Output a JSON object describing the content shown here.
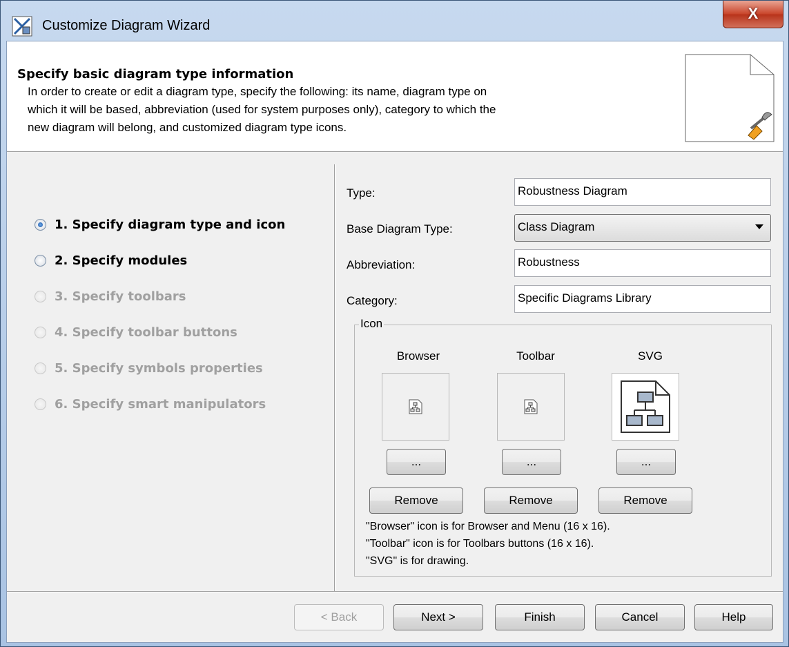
{
  "window": {
    "title": "Customize Diagram Wizard",
    "close_label": "X"
  },
  "header": {
    "title": "Specify basic diagram type information",
    "desc_lines": [
      "In order to create or edit a diagram type, specify the following: its name, diagram type on",
      "which it will be based, abbreviation (used for system purposes only), category to which the",
      "new diagram will belong, and customized diagram type icons."
    ]
  },
  "steps": [
    {
      "label": "1. Specify diagram type and icon",
      "selected": true,
      "enabled": true
    },
    {
      "label": "2. Specify modules",
      "selected": false,
      "enabled": true
    },
    {
      "label": "3. Specify toolbars",
      "selected": false,
      "enabled": false
    },
    {
      "label": "4. Specify toolbar buttons",
      "selected": false,
      "enabled": false
    },
    {
      "label": "5. Specify symbols properties",
      "selected": false,
      "enabled": false
    },
    {
      "label": "6. Specify smart manipulators",
      "selected": false,
      "enabled": false
    }
  ],
  "form": {
    "type_label": "Type:",
    "type_value": "Robustness Diagram",
    "base_label": "Base Diagram Type:",
    "base_value": "Class Diagram",
    "abbr_label": "Abbreviation:",
    "abbr_value": "Robustness",
    "category_label": "Category:",
    "category_value": "Specific Diagrams Library"
  },
  "icon_group": {
    "legend": "Icon",
    "columns": [
      {
        "label": "Browser",
        "browse": "...",
        "remove": "Remove"
      },
      {
        "label": "Toolbar",
        "browse": "...",
        "remove": "Remove"
      },
      {
        "label": "SVG",
        "browse": "...",
        "remove": "Remove"
      }
    ],
    "notes": [
      "\"Browser\" icon is for Browser and Menu (16 x 16).",
      "\"Toolbar\" icon is for Toolbars buttons (16 x 16).",
      "\"SVG\" is for drawing."
    ]
  },
  "buttons": {
    "back": "< Back",
    "next": "Next >",
    "finish": "Finish",
    "cancel": "Cancel",
    "help": "Help"
  }
}
